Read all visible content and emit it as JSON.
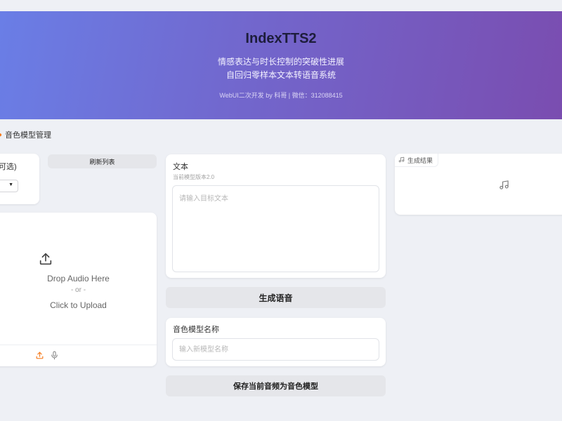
{
  "header": {
    "title": "IndexTTS2",
    "subtitle_line1": "情感表达与时长控制的突破性进展",
    "subtitle_line2": "自回归零样本文本转语音系统",
    "credit": "WebUI二次开发 by 科哥 | 微信：312088415"
  },
  "section": {
    "title": "音色模型管理"
  },
  "left": {
    "select_label": "可选)",
    "refresh_label": "刷新列表",
    "upload": {
      "drop_text": "Drop Audio Here",
      "or_text": "- or -",
      "click_text": "Click to Upload"
    }
  },
  "middle": {
    "text_label": "文本",
    "text_info": "当前模型版本2.0",
    "text_placeholder": "请输入目标文本",
    "generate_label": "生成语音",
    "name_label": "音色模型名称",
    "name_placeholder": "输入新模型名称",
    "save_label": "保存当前音频为音色模型"
  },
  "right": {
    "result_label": "生成结果"
  },
  "colors": {
    "gradient_start": "#6a7ee6",
    "gradient_end": "#7a4db0",
    "accent": "#f57c1f",
    "background": "#eef0f5"
  },
  "icons": {
    "section": "bullet-icon",
    "upload": "upload-icon",
    "source_upload": "upload-icon",
    "source_mic": "microphone-icon",
    "result_tag": "music-note-icon",
    "result_empty": "music-note-icon",
    "dropdown": "caret-down-icon"
  }
}
